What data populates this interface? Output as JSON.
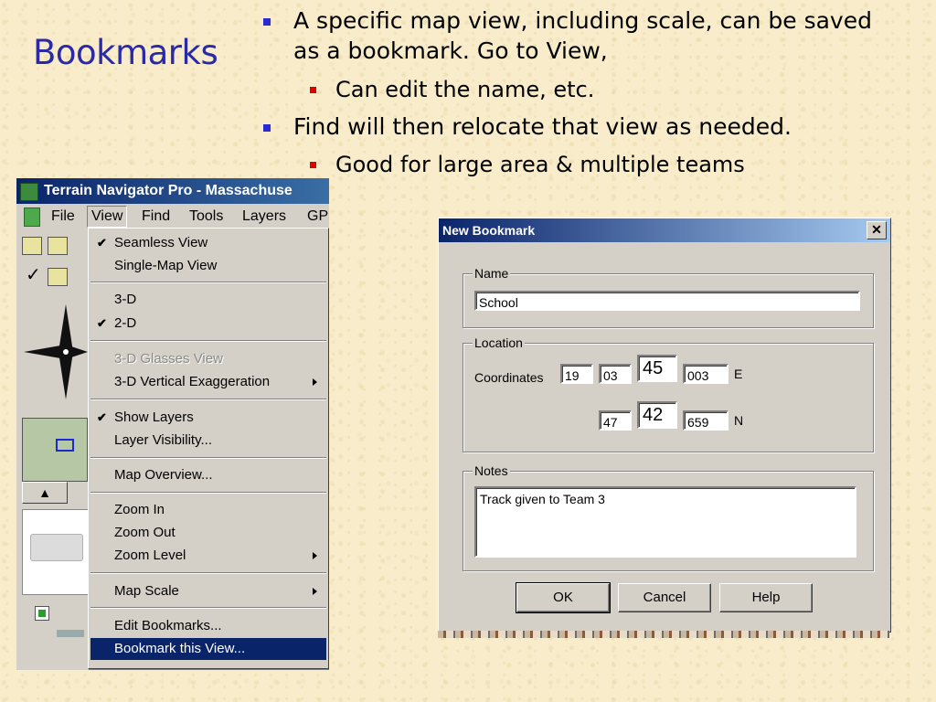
{
  "slide": {
    "title": "Bookmarks",
    "bullets": [
      {
        "level": 1,
        "text_line1": "A specific map view, including scale, can be saved",
        "text_line2": "as a bookmark.  Go to View,"
      },
      {
        "level": 2,
        "text": "Can edit the name, etc."
      },
      {
        "level": 1,
        "text": "Find will then relocate that view as needed."
      },
      {
        "level": 2,
        "text": "Good for large area & multiple teams"
      }
    ],
    "colors": {
      "title": "#2a2aa8",
      "bullet_level1": "#2a2ad0",
      "bullet_level2": "#e00000",
      "background": "#f8eccb"
    }
  },
  "terrain_window": {
    "title": "Terrain Navigator Pro - Massachuse",
    "menus": [
      "File",
      "View",
      "Find",
      "Tools",
      "Layers",
      "GPS"
    ],
    "active_menu": "View",
    "view_menu": {
      "items": [
        {
          "label": "Seamless View",
          "checked": true
        },
        {
          "label": "Single-Map View"
        },
        {
          "label": "3-D"
        },
        {
          "label": "2-D",
          "checked": true
        },
        {
          "label": "3-D Glasses View",
          "disabled": true
        },
        {
          "label": "3-D Vertical Exaggeration",
          "submenu": true
        },
        {
          "label": "Show Layers",
          "checked": true
        },
        {
          "label": "Layer Visibility..."
        },
        {
          "label": "Map Overview..."
        },
        {
          "label": "Zoom In"
        },
        {
          "label": "Zoom Out"
        },
        {
          "label": "Zoom Level",
          "submenu": true
        },
        {
          "label": "Map Scale",
          "submenu": true
        },
        {
          "label": "Edit Bookmarks..."
        },
        {
          "label": "Bookmark this View...",
          "highlighted": true
        }
      ]
    }
  },
  "new_bookmark_dialog": {
    "title": "New Bookmark",
    "close_glyph": "✕",
    "name_group": {
      "label": "Name",
      "value": "School"
    },
    "location_group": {
      "label": "Location",
      "coordinates_label": "Coordinates",
      "row1": {
        "deg": "19",
        "min": "03",
        "sec": "45",
        "dec": "003",
        "dir": "E"
      },
      "row2": {
        "min": "47",
        "sec": "42",
        "dec": "659",
        "dir": "N"
      }
    },
    "notes_group": {
      "label": "Notes",
      "value": "Track given to Team 3"
    },
    "buttons": {
      "ok": "OK",
      "cancel": "Cancel",
      "help": "Help"
    }
  }
}
